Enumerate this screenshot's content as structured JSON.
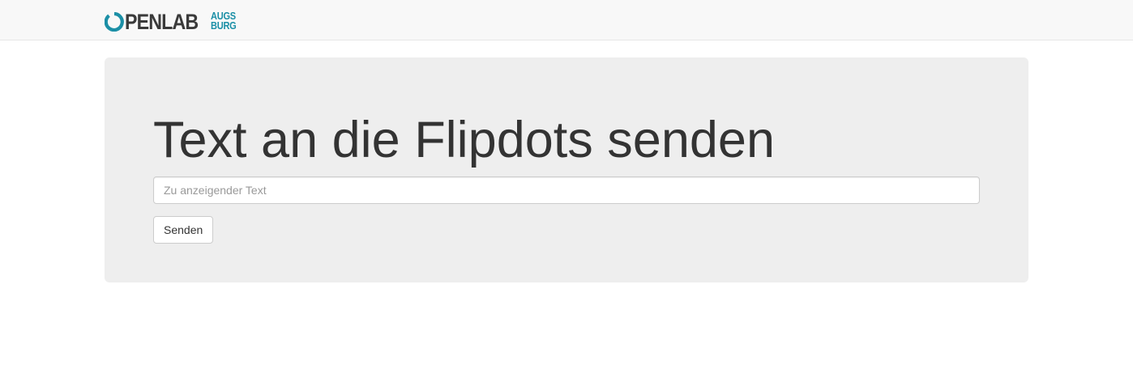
{
  "navbar": {
    "brand": {
      "main": "PENLAB",
      "sub_top": "AUGS",
      "sub_bottom": "BURG",
      "ring_icon": "openlab-ring-logo-icon"
    }
  },
  "jumbotron": {
    "title": "Text an die Flipdots senden",
    "input": {
      "placeholder": "Zu anzeigender Text",
      "value": ""
    },
    "send_label": "Senden"
  },
  "colors": {
    "brand_teal": "#1b8fa6",
    "brand_dark": "#3a3a3a",
    "navbar_bg": "#f8f8f8",
    "jumbotron_bg": "#eeeeee",
    "text": "#333333"
  }
}
